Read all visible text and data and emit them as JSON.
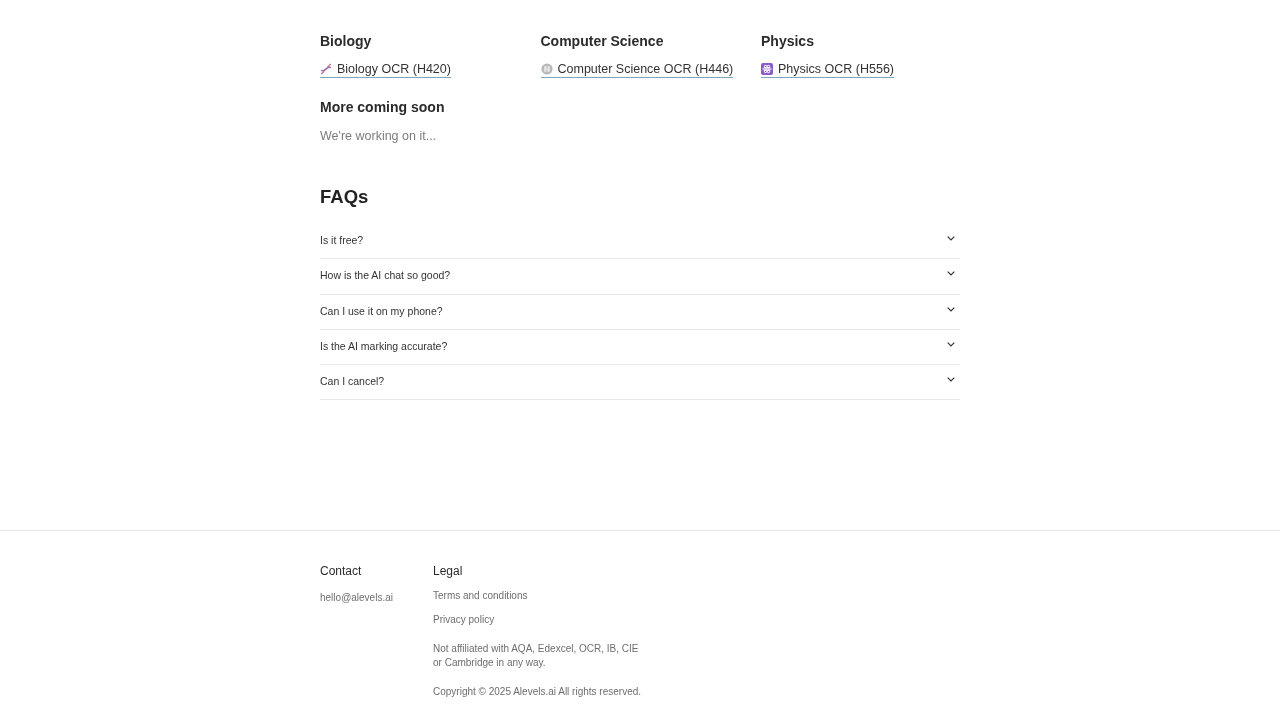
{
  "subjects": [
    {
      "heading": "Biology",
      "links": [
        {
          "label": "Biology OCR (H420)"
        }
      ]
    },
    {
      "heading": "Computer Science",
      "links": [
        {
          "label": "Computer Science OCR (H446)"
        }
      ]
    },
    {
      "heading": "Physics",
      "links": [
        {
          "label": "Physics OCR (H556)"
        }
      ]
    }
  ],
  "more": {
    "heading": "More coming soon",
    "text": "We're working on it..."
  },
  "faqs": {
    "heading": "FAQs",
    "items": [
      {
        "question": "Is it free?",
        "expanded": false
      },
      {
        "question": "How is the AI chat so good?",
        "expanded": false
      },
      {
        "question": "Can I use it on my phone?",
        "expanded": false
      },
      {
        "question": "Is the AI marking accurate?",
        "expanded": false
      },
      {
        "question": "Can I cancel?",
        "expanded": false
      }
    ]
  },
  "footer": {
    "contact": {
      "heading": "Contact",
      "email": "hello@alevels.ai"
    },
    "legal": {
      "heading": "Legal",
      "links": [
        "Terms and conditions",
        "Privacy policy"
      ],
      "disclaimer": "Not affiliated with AQA, Edexcel, OCR, IB, CIE or Cambridge in any way.",
      "copyright": "Copyright © 2025 Alevels.ai All rights reserved."
    }
  }
}
